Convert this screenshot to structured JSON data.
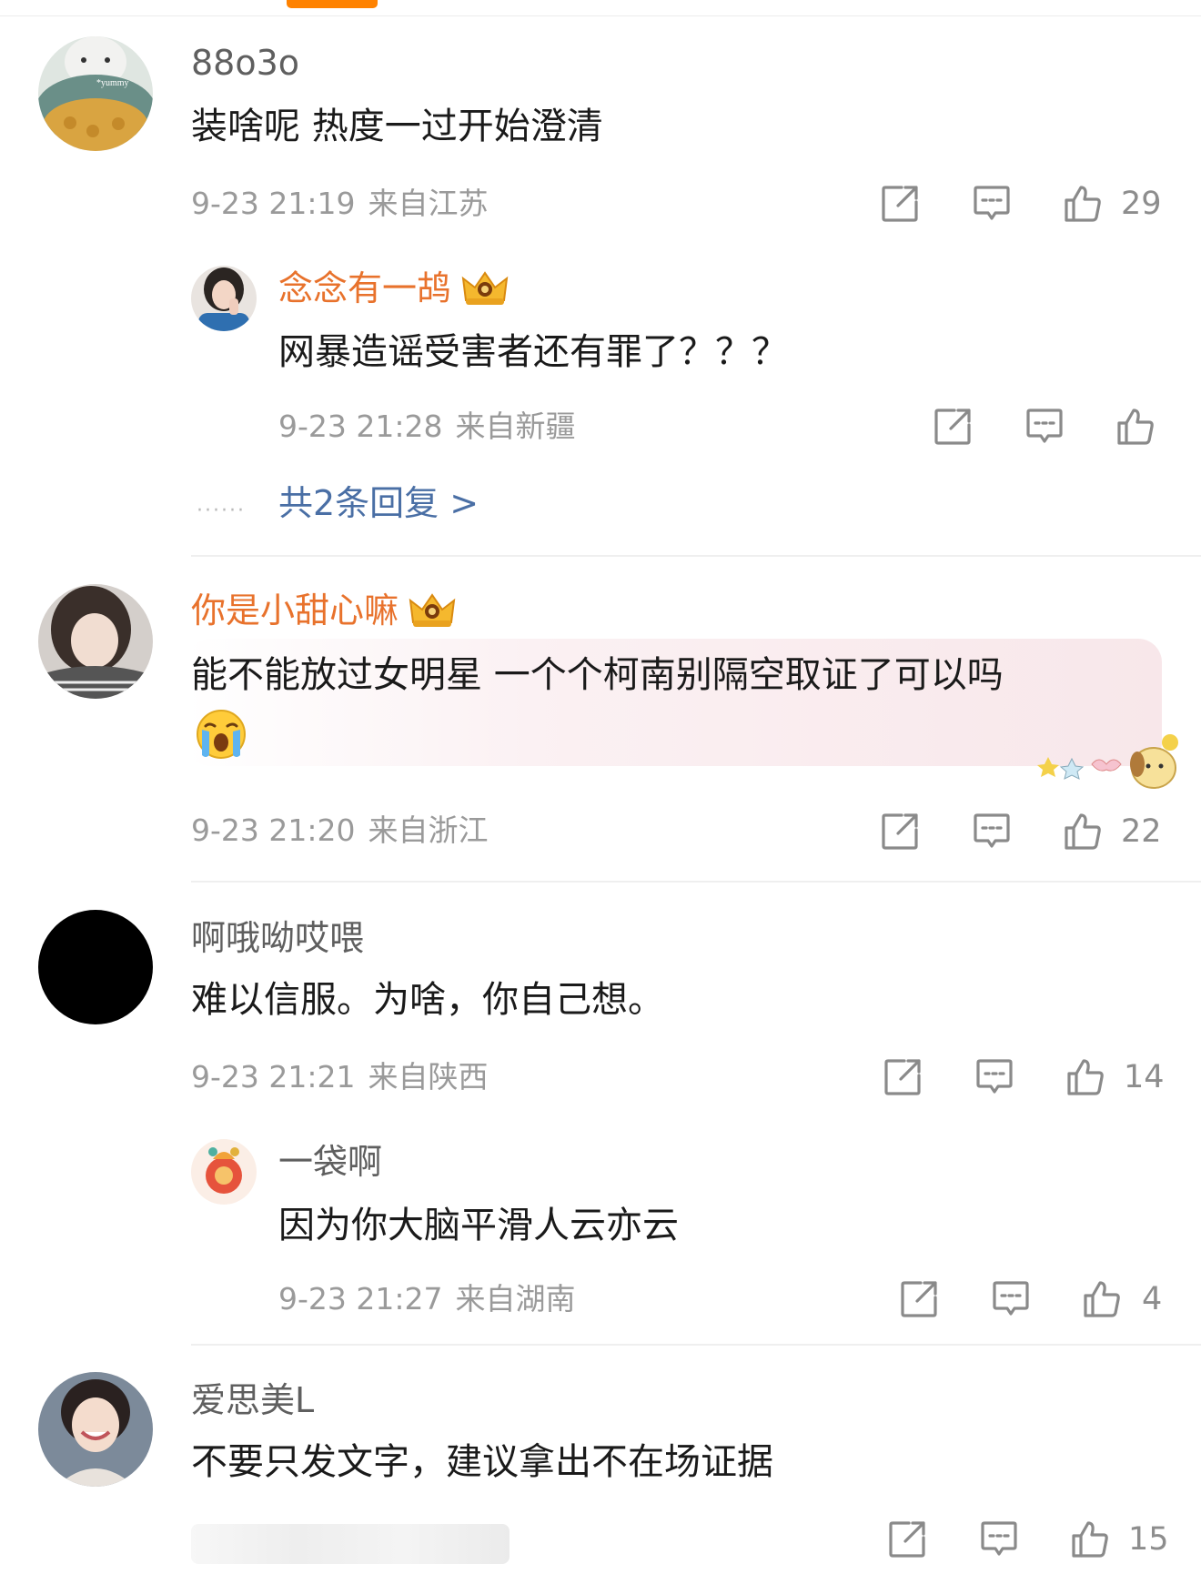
{
  "comments": [
    {
      "username": "88o3o",
      "text": "装啥呢 热度一过开始澄清",
      "time": "9-23 21:19",
      "location": "来自江苏",
      "likes": "29",
      "avatar_caption": "*yummy",
      "replies": [
        {
          "username": "念念有一鸪",
          "text": "网暴造谣受害者还有罪了？？？",
          "time": "9-23 21:28",
          "location": "来自新疆",
          "likes": ""
        }
      ],
      "more_replies": "共2条回复 >"
    },
    {
      "username": "你是小甜心嘛",
      "text_line1": "能不能放过女明星 一个个柯南别隔空取证了可以吗",
      "emoji": "crying-face",
      "time": "9-23 21:20",
      "location": "来自浙江",
      "likes": "22"
    },
    {
      "username": "啊哦呦哎喂",
      "text": "难以信服。为啥，你自己想。",
      "time": "9-23 21:21",
      "location": "来自陕西",
      "likes": "14",
      "replies": [
        {
          "username": "一袋啊",
          "text": "因为你大脑平滑人云亦云",
          "time": "9-23 21:27",
          "location": "来自湖南",
          "likes": "4"
        }
      ]
    },
    {
      "username": "爱思美L",
      "text": "不要只发文字，建议拿出不在场证据",
      "likes": "15"
    }
  ],
  "colors": {
    "accent": "#ff8200",
    "vip_name": "#e8722c",
    "link": "#4a6fa5",
    "meta": "#9a9a9a"
  },
  "icons": {
    "share": "share-icon",
    "comment": "comment-icon",
    "like": "like-icon",
    "vip": "crown-icon"
  }
}
